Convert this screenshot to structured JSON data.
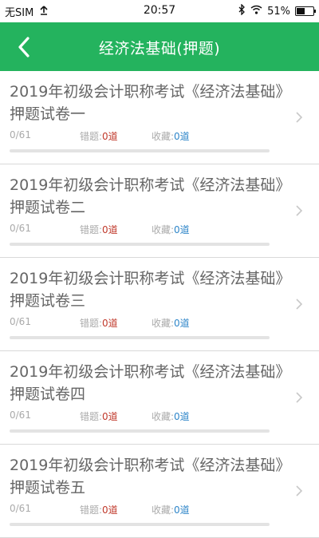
{
  "status_bar": {
    "carrier": "无SIM",
    "time": "20:57",
    "battery_text": "51%",
    "battery_level": 0.51
  },
  "header": {
    "title": "经济法基础(押题)"
  },
  "items": [
    {
      "title": "2019年初级会计职称考试《经济法基础》押题试卷一",
      "progress": "0/61",
      "progress_fraction": 0,
      "wrong_label": "错题:",
      "wrong_value": "0道",
      "fav_label": "收藏:",
      "fav_value": "0道"
    },
    {
      "title": "2019年初级会计职称考试《经济法基础》押题试卷二",
      "progress": "0/61",
      "progress_fraction": 0,
      "wrong_label": "错题:",
      "wrong_value": "0道",
      "fav_label": "收藏:",
      "fav_value": "0道"
    },
    {
      "title": "2019年初级会计职称考试《经济法基础》押题试卷三",
      "progress": "0/61",
      "progress_fraction": 0,
      "wrong_label": "错题:",
      "wrong_value": "0道",
      "fav_label": "收藏:",
      "fav_value": "0道"
    },
    {
      "title": "2019年初级会计职称考试《经济法基础》押题试卷四",
      "progress": "0/61",
      "progress_fraction": 0,
      "wrong_label": "错题:",
      "wrong_value": "0道",
      "fav_label": "收藏:",
      "fav_value": "0道"
    },
    {
      "title": "2019年初级会计职称考试《经济法基础》押题试卷五",
      "progress": "0/61",
      "progress_fraction": 0,
      "wrong_label": "错题:",
      "wrong_value": "0道",
      "fav_label": "收藏:",
      "fav_value": "0道"
    }
  ],
  "colors": {
    "accent": "#24b35e",
    "wrong": "#c0392b",
    "favorite": "#2f86c9"
  },
  "icons": {
    "back": "chevron-left-icon",
    "row_arrow": "chevron-right-icon",
    "bluetooth": "bluetooth-icon",
    "wifi": "wifi-icon",
    "battery": "battery-icon",
    "upload": "arrow-up-icon"
  }
}
